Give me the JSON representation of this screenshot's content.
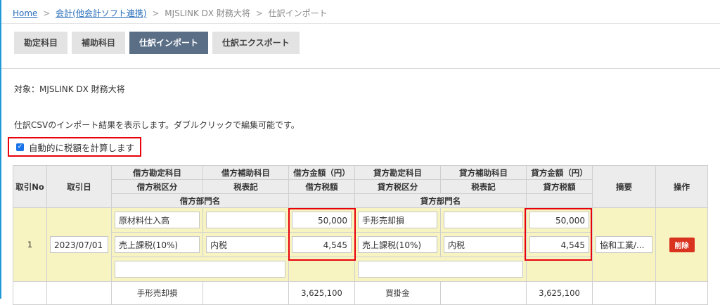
{
  "breadcrumb": {
    "home": "Home",
    "accounting": "会計(他会計ソフト連携)",
    "software": "MJSLINK DX 財務大将",
    "current": "仕訳インポート",
    "sep": ">"
  },
  "tabs": [
    "勘定科目",
    "補助科目",
    "仕訳インポート",
    "仕訳エクスポート"
  ],
  "target_label": "対象：MJSLINK DX 財務大将",
  "description": "仕訳CSVのインポート結果を表示します。ダブルクリックで編集可能です。",
  "auto_tax": {
    "label": "自動的に税額を計算します",
    "checked": true
  },
  "table": {
    "h_no": "取引No",
    "h_date": "取引日",
    "h_debit_account": "借方勘定科目",
    "h_debit_sub": "借方補助科目",
    "h_debit_amount": "借方金額（円）",
    "h_credit_account": "貸方勘定科目",
    "h_credit_sub": "貸方補助科目",
    "h_credit_amount": "貸方金額（円）",
    "h_debit_taxcat": "借方税区分",
    "h_taxmark": "税表記",
    "h_debit_tax": "借方税額",
    "h_credit_taxcat": "貸方税区分",
    "h_taxmark2": "税表記",
    "h_credit_tax": "貸方税額",
    "h_debit_dept": "借方部門名",
    "h_credit_dept": "貸方部門名",
    "h_memo": "摘要",
    "h_action": "操作",
    "row1": {
      "no": "1",
      "date": "2023/07/01",
      "debit_account": "原材料仕入高",
      "debit_sub": "",
      "debit_amount": "50,000",
      "credit_account": "手形売却損",
      "credit_sub": "",
      "credit_amount": "50,000",
      "debit_taxcat": "売上課税(10%)",
      "debit_taxmark": "内税",
      "debit_tax": "4,545",
      "credit_taxcat": "売上課税(10%)",
      "credit_taxmark": "内税",
      "credit_tax": "4,545",
      "debit_dept": "",
      "credit_dept": "",
      "memo": "協和工業/...",
      "delete_label": "削除"
    },
    "row2": {
      "debit_account": "手形売却損",
      "debit_amount": "3,625,100",
      "credit_account": "買掛金",
      "credit_amount": "3,625,100"
    }
  }
}
